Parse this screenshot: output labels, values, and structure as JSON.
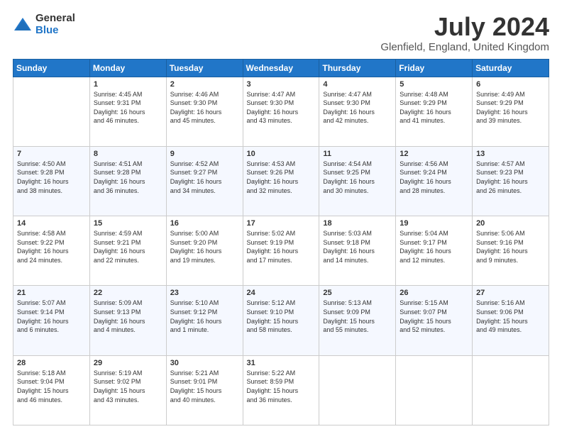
{
  "logo": {
    "general": "General",
    "blue": "Blue"
  },
  "title": "July 2024",
  "subtitle": "Glenfield, England, United Kingdom",
  "headers": [
    "Sunday",
    "Monday",
    "Tuesday",
    "Wednesday",
    "Thursday",
    "Friday",
    "Saturday"
  ],
  "weeks": [
    [
      {
        "day": "",
        "content": ""
      },
      {
        "day": "1",
        "content": "Sunrise: 4:45 AM\nSunset: 9:31 PM\nDaylight: 16 hours\nand 46 minutes."
      },
      {
        "day": "2",
        "content": "Sunrise: 4:46 AM\nSunset: 9:30 PM\nDaylight: 16 hours\nand 45 minutes."
      },
      {
        "day": "3",
        "content": "Sunrise: 4:47 AM\nSunset: 9:30 PM\nDaylight: 16 hours\nand 43 minutes."
      },
      {
        "day": "4",
        "content": "Sunrise: 4:47 AM\nSunset: 9:30 PM\nDaylight: 16 hours\nand 42 minutes."
      },
      {
        "day": "5",
        "content": "Sunrise: 4:48 AM\nSunset: 9:29 PM\nDaylight: 16 hours\nand 41 minutes."
      },
      {
        "day": "6",
        "content": "Sunrise: 4:49 AM\nSunset: 9:29 PM\nDaylight: 16 hours\nand 39 minutes."
      }
    ],
    [
      {
        "day": "7",
        "content": "Sunrise: 4:50 AM\nSunset: 9:28 PM\nDaylight: 16 hours\nand 38 minutes."
      },
      {
        "day": "8",
        "content": "Sunrise: 4:51 AM\nSunset: 9:28 PM\nDaylight: 16 hours\nand 36 minutes."
      },
      {
        "day": "9",
        "content": "Sunrise: 4:52 AM\nSunset: 9:27 PM\nDaylight: 16 hours\nand 34 minutes."
      },
      {
        "day": "10",
        "content": "Sunrise: 4:53 AM\nSunset: 9:26 PM\nDaylight: 16 hours\nand 32 minutes."
      },
      {
        "day": "11",
        "content": "Sunrise: 4:54 AM\nSunset: 9:25 PM\nDaylight: 16 hours\nand 30 minutes."
      },
      {
        "day": "12",
        "content": "Sunrise: 4:56 AM\nSunset: 9:24 PM\nDaylight: 16 hours\nand 28 minutes."
      },
      {
        "day": "13",
        "content": "Sunrise: 4:57 AM\nSunset: 9:23 PM\nDaylight: 16 hours\nand 26 minutes."
      }
    ],
    [
      {
        "day": "14",
        "content": "Sunrise: 4:58 AM\nSunset: 9:22 PM\nDaylight: 16 hours\nand 24 minutes."
      },
      {
        "day": "15",
        "content": "Sunrise: 4:59 AM\nSunset: 9:21 PM\nDaylight: 16 hours\nand 22 minutes."
      },
      {
        "day": "16",
        "content": "Sunrise: 5:00 AM\nSunset: 9:20 PM\nDaylight: 16 hours\nand 19 minutes."
      },
      {
        "day": "17",
        "content": "Sunrise: 5:02 AM\nSunset: 9:19 PM\nDaylight: 16 hours\nand 17 minutes."
      },
      {
        "day": "18",
        "content": "Sunrise: 5:03 AM\nSunset: 9:18 PM\nDaylight: 16 hours\nand 14 minutes."
      },
      {
        "day": "19",
        "content": "Sunrise: 5:04 AM\nSunset: 9:17 PM\nDaylight: 16 hours\nand 12 minutes."
      },
      {
        "day": "20",
        "content": "Sunrise: 5:06 AM\nSunset: 9:16 PM\nDaylight: 16 hours\nand 9 minutes."
      }
    ],
    [
      {
        "day": "21",
        "content": "Sunrise: 5:07 AM\nSunset: 9:14 PM\nDaylight: 16 hours\nand 6 minutes."
      },
      {
        "day": "22",
        "content": "Sunrise: 5:09 AM\nSunset: 9:13 PM\nDaylight: 16 hours\nand 4 minutes."
      },
      {
        "day": "23",
        "content": "Sunrise: 5:10 AM\nSunset: 9:12 PM\nDaylight: 16 hours\nand 1 minute."
      },
      {
        "day": "24",
        "content": "Sunrise: 5:12 AM\nSunset: 9:10 PM\nDaylight: 15 hours\nand 58 minutes."
      },
      {
        "day": "25",
        "content": "Sunrise: 5:13 AM\nSunset: 9:09 PM\nDaylight: 15 hours\nand 55 minutes."
      },
      {
        "day": "26",
        "content": "Sunrise: 5:15 AM\nSunset: 9:07 PM\nDaylight: 15 hours\nand 52 minutes."
      },
      {
        "day": "27",
        "content": "Sunrise: 5:16 AM\nSunset: 9:06 PM\nDaylight: 15 hours\nand 49 minutes."
      }
    ],
    [
      {
        "day": "28",
        "content": "Sunrise: 5:18 AM\nSunset: 9:04 PM\nDaylight: 15 hours\nand 46 minutes."
      },
      {
        "day": "29",
        "content": "Sunrise: 5:19 AM\nSunset: 9:02 PM\nDaylight: 15 hours\nand 43 minutes."
      },
      {
        "day": "30",
        "content": "Sunrise: 5:21 AM\nSunset: 9:01 PM\nDaylight: 15 hours\nand 40 minutes."
      },
      {
        "day": "31",
        "content": "Sunrise: 5:22 AM\nSunset: 8:59 PM\nDaylight: 15 hours\nand 36 minutes."
      },
      {
        "day": "",
        "content": ""
      },
      {
        "day": "",
        "content": ""
      },
      {
        "day": "",
        "content": ""
      }
    ]
  ]
}
